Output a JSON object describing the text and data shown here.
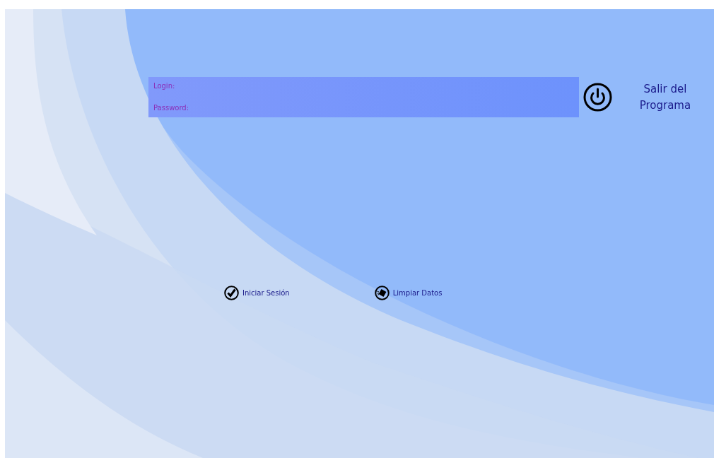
{
  "login_form": {
    "fields": [
      {
        "label": "Login:"
      },
      {
        "label": "Password:"
      }
    ]
  },
  "exit_button": {
    "label": "Salir del Programa"
  },
  "buttons": [
    {
      "label": "Iniciar Sesión",
      "kind": "confirm"
    },
    {
      "label": "Limpiar Datos",
      "kind": "clear"
    }
  ]
}
